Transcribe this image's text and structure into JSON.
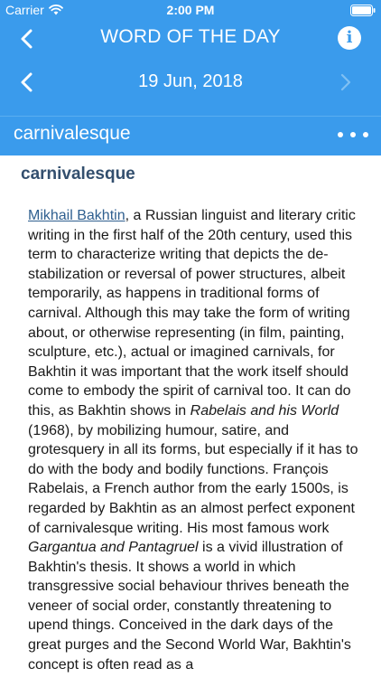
{
  "status_bar": {
    "carrier": "Carrier",
    "time": "2:00 PM"
  },
  "nav": {
    "title": "WORD OF THE DAY",
    "info_label": "i"
  },
  "date_nav": {
    "date": "19 Jun, 2018"
  },
  "word_bar": {
    "word": "carnivalesque"
  },
  "entry": {
    "headword": "carnivalesque",
    "link_text": "Mikhail Bakhtin",
    "p1": ", a Russian linguist and literary critic writing in the first half of the 20th century, used this term to characterize writing that depicts the de-stabilization or reversal of power structures, albeit temporarily, as happens in traditional forms of carnival. Although this may take the form of writing about, or otherwise representing (in film, painting, sculpture, etc.), actual or imagined carnivals, for Bakhtin it was important that the work itself should come to embody the spirit of carnival too. It can do this, as Bakhtin shows in ",
    "italic1": "Rabelais and his World",
    "p2": " (1968), by mobilizing humour, satire, and grotesquery in all its forms, but especially if it has to do with the body and bodily functions. François Rabelais, a French author from the early 1500s, is regarded by Bakhtin as an almost perfect exponent of carnivalesque writing. His most famous work ",
    "italic2": "Gargantua and Pantagruel",
    "p3": " is a vivid illustration of Bakhtin's thesis. It shows a world in which transgressive social behaviour thrives beneath the veneer of social order, constantly threatening to upend things. Conceived in the dark days of the great purges and the Second World War, Bakhtin's concept is often read as a"
  },
  "colors": {
    "header_blue": "#3a9bec",
    "headword_color": "#334f6e",
    "link_color": "#2f5f8f",
    "disabled_arrow": "#7fc0f3"
  },
  "icons": {
    "wifi": "wifi-icon",
    "battery": "battery-icon",
    "back": "chevron-left-icon",
    "info": "info-icon",
    "prev": "chevron-left-icon",
    "next": "chevron-right-icon",
    "more": "more-dots-icon"
  }
}
